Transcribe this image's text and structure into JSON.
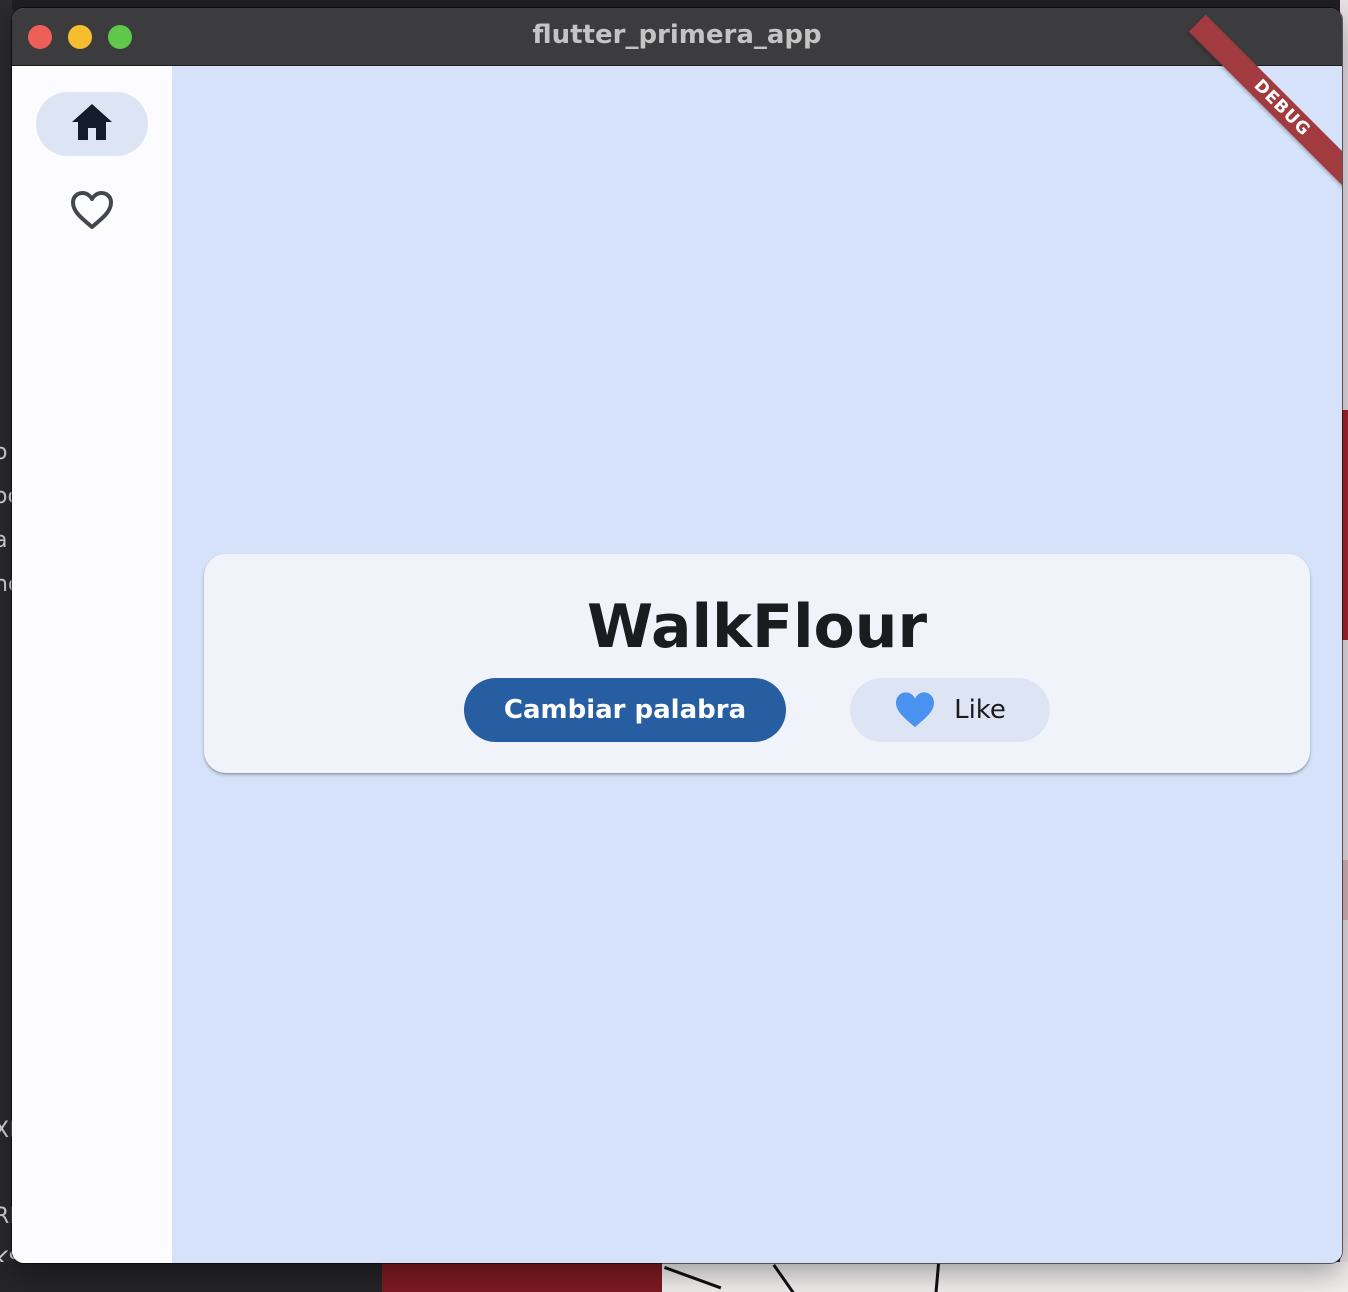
{
  "window": {
    "title": "flutter_primera_app"
  },
  "rail": {
    "items": [
      {
        "icon": "home-icon",
        "selected": true
      },
      {
        "icon": "heart-outline-icon",
        "selected": false
      }
    ]
  },
  "card": {
    "word": "WalkFlour",
    "next_label": "Cambiar palabra",
    "like_label": "Like"
  },
  "debug_banner": "DEBUG",
  "colors": {
    "accent": "#265ea1",
    "background": "#d5e2fa",
    "rail_indicator": "#dde4f4",
    "heart": "#4a92f0"
  },
  "desktop_fragments": [
    "o",
    "oc",
    "a",
    "no",
    "XF",
    "RI",
    "KS"
  ]
}
